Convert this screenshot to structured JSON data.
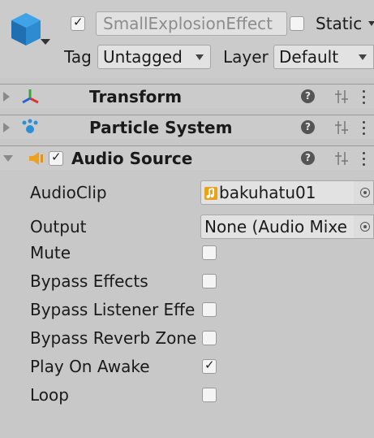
{
  "gameobject": {
    "active": true,
    "name": "SmallExplosionEffect",
    "static_label": "Static",
    "tag_label": "Tag",
    "tag_value": "Untagged",
    "layer_label": "Layer",
    "layer_value": "Default"
  },
  "components": [
    {
      "name": "Transform",
      "icon": "transform-axes-icon",
      "expanded": false
    },
    {
      "name": "Particle System",
      "icon": "particle-system-icon",
      "expanded": false
    },
    {
      "name": "Audio Source",
      "icon": "audio-source-icon",
      "expanded": true,
      "enabled": true
    }
  ],
  "audio_source": {
    "properties": [
      {
        "label": "AudioClip",
        "value": "bakuhatu01",
        "kind": "object",
        "icon": "audio-clip-icon"
      },
      {
        "label": "Output",
        "value": "None (Audio Mixe",
        "kind": "object"
      },
      {
        "label": "Mute",
        "checked": false,
        "kind": "toggle"
      },
      {
        "label": "Bypass Effects",
        "checked": false,
        "kind": "toggle"
      },
      {
        "label": "Bypass Listener Effe",
        "checked": false,
        "kind": "toggle"
      },
      {
        "label": "Bypass Reverb Zone",
        "checked": false,
        "kind": "toggle"
      },
      {
        "label": "Play On Awake",
        "checked": true,
        "kind": "toggle"
      },
      {
        "label": "Loop",
        "checked": false,
        "kind": "toggle"
      }
    ]
  },
  "colors": {
    "header_bg": "#cbcbcb",
    "panel_bg": "#c8c8c8",
    "audio_clip_icon": "#e8a317",
    "particle_icon": "#2a8fd6",
    "transform_x": "#d33",
    "transform_y": "#3a3",
    "transform_z": "#26c",
    "audio_source_icon": "#f0a020"
  }
}
